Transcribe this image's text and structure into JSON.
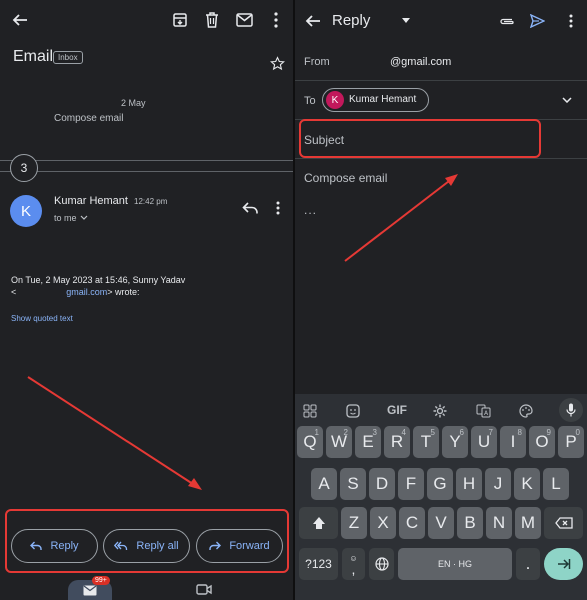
{
  "left": {
    "title": "Email",
    "badge": "Inbox",
    "date": "2 May",
    "compose_preview": "Compose email",
    "collapsed_count": "3",
    "sender": {
      "initial": "K",
      "name": "Kumar Hemant",
      "time": "12:42 pm",
      "to_label": "to me"
    },
    "quote_line1": "On Tue, 2 May 2023 at 15:46, Sunny Yadav",
    "quote_line2_prefix": "<",
    "quote_link": "gmail.com",
    "quote_line2_suffix": "> wrote:",
    "show_quoted": "Show quoted text",
    "actions": {
      "reply": "Reply",
      "reply_all": "Reply all",
      "forward": "Forward"
    },
    "mail_badge": "99+"
  },
  "right": {
    "title": "Reply",
    "from_label": "From",
    "from_value": "@gmail.com",
    "to_label": "To",
    "recipient_initial": "K",
    "recipient_name": "Kumar Hemant",
    "subject_placeholder": "Subject",
    "compose_placeholder": "Compose email",
    "ellipsis": "...",
    "keyboard": {
      "gif": "GIF",
      "row1": [
        "Q",
        "W",
        "E",
        "R",
        "T",
        "Y",
        "U",
        "I",
        "O",
        "P"
      ],
      "row1_nums": [
        "1",
        "2",
        "3",
        "4",
        "5",
        "6",
        "7",
        "8",
        "9",
        "0"
      ],
      "row2": [
        "A",
        "S",
        "D",
        "F",
        "G",
        "H",
        "J",
        "K",
        "L"
      ],
      "row3": [
        "Z",
        "X",
        "C",
        "V",
        "B",
        "N",
        "M"
      ],
      "sym_key": "?123",
      "comma": ",",
      "space": "EN · HG",
      "period": "."
    }
  },
  "colors": {
    "accent": "#8ab4f8",
    "avatar_blue": "#5b8def",
    "avatar_pink": "#c2185b",
    "annotation_red": "#e53935",
    "enter_key": "#8ed4c7"
  }
}
